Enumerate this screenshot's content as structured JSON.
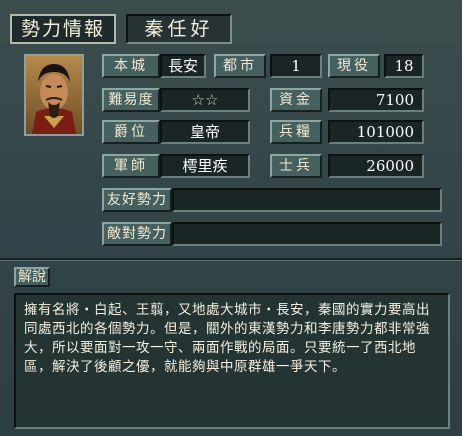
{
  "header": {
    "title": "勢力情報",
    "faction_name": "秦任好"
  },
  "portrait": {
    "icon": "ruler-portrait-icon"
  },
  "stats": {
    "home_city_label": "本城",
    "home_city_value": "長安",
    "cities_label": "都市",
    "cities_value": "1",
    "officers_label": "現役",
    "officers_value": "18",
    "difficulty_label": "難易度",
    "difficulty_value": "☆☆",
    "funds_label": "資金",
    "funds_value": "7100",
    "rank_label": "爵位",
    "rank_value": "皇帝",
    "provisions_label": "兵糧",
    "provisions_value": "101000",
    "advisor_label": "軍師",
    "advisor_value": "樗里疾",
    "soldiers_label": "士兵",
    "soldiers_value": "26000"
  },
  "relations": {
    "allied_label": "友好勢力",
    "allied_value": "",
    "hostile_label": "敵對勢力",
    "hostile_value": ""
  },
  "explanation": {
    "tab_label": "解說",
    "text": "擁有名將・白起、王翦，又地處大城市・長安，秦國的實力要高出同處西北的各個勢力。但是，關外的東漢勢力和李唐勢力都非常強大，所以要面對一攻一守、兩面作戰的局面。只要統一了西北地區，解決了後顧之優，就能夠與中原群雄一爭天下。"
  }
}
